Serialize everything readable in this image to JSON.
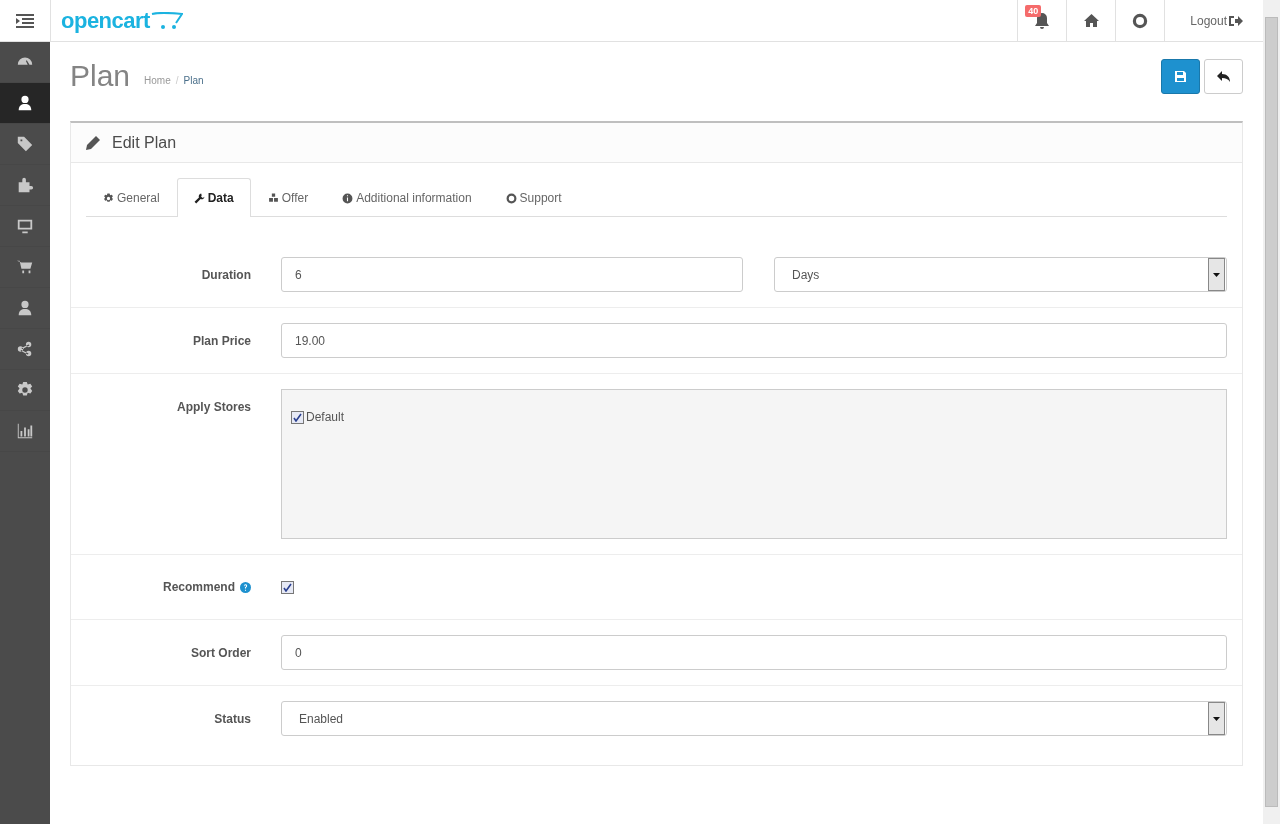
{
  "header": {
    "logo": "opencart",
    "notifications": "40",
    "logout": "Logout"
  },
  "sidebar": [
    {
      "selected": false
    },
    {
      "selected": true
    },
    {
      "selected": false
    },
    {
      "selected": false
    },
    {
      "selected": false
    },
    {
      "selected": false
    },
    {
      "selected": false
    },
    {
      "selected": false
    },
    {
      "selected": false
    },
    {
      "selected": false
    }
  ],
  "page": {
    "title": "Plan",
    "breadcrumb": [
      "Home",
      "Plan"
    ],
    "separator": "/"
  },
  "panel": {
    "title": "Edit Plan"
  },
  "tabs": [
    {
      "label": "General",
      "selected": false
    },
    {
      "label": "Data",
      "selected": true
    },
    {
      "label": "Offer",
      "selected": false
    },
    {
      "label": "Additional information",
      "selected": false
    },
    {
      "label": "Support",
      "selected": false
    }
  ],
  "fields": [
    {
      "kind": "input-select",
      "label": "Duration",
      "value": "6",
      "option": "Days"
    },
    {
      "kind": "input",
      "label": "Plan Price",
      "value": "19.00"
    },
    {
      "kind": "checklist",
      "label": "Apply Stores",
      "items": [
        {
          "label": "Default",
          "checked": true
        }
      ]
    },
    {
      "kind": "checkbox",
      "label": "Recommend",
      "help": true,
      "checked": true
    },
    {
      "kind": "input",
      "label": "Sort Order",
      "value": "0"
    },
    {
      "kind": "select",
      "label": "Status",
      "option": "Enabled"
    }
  ]
}
